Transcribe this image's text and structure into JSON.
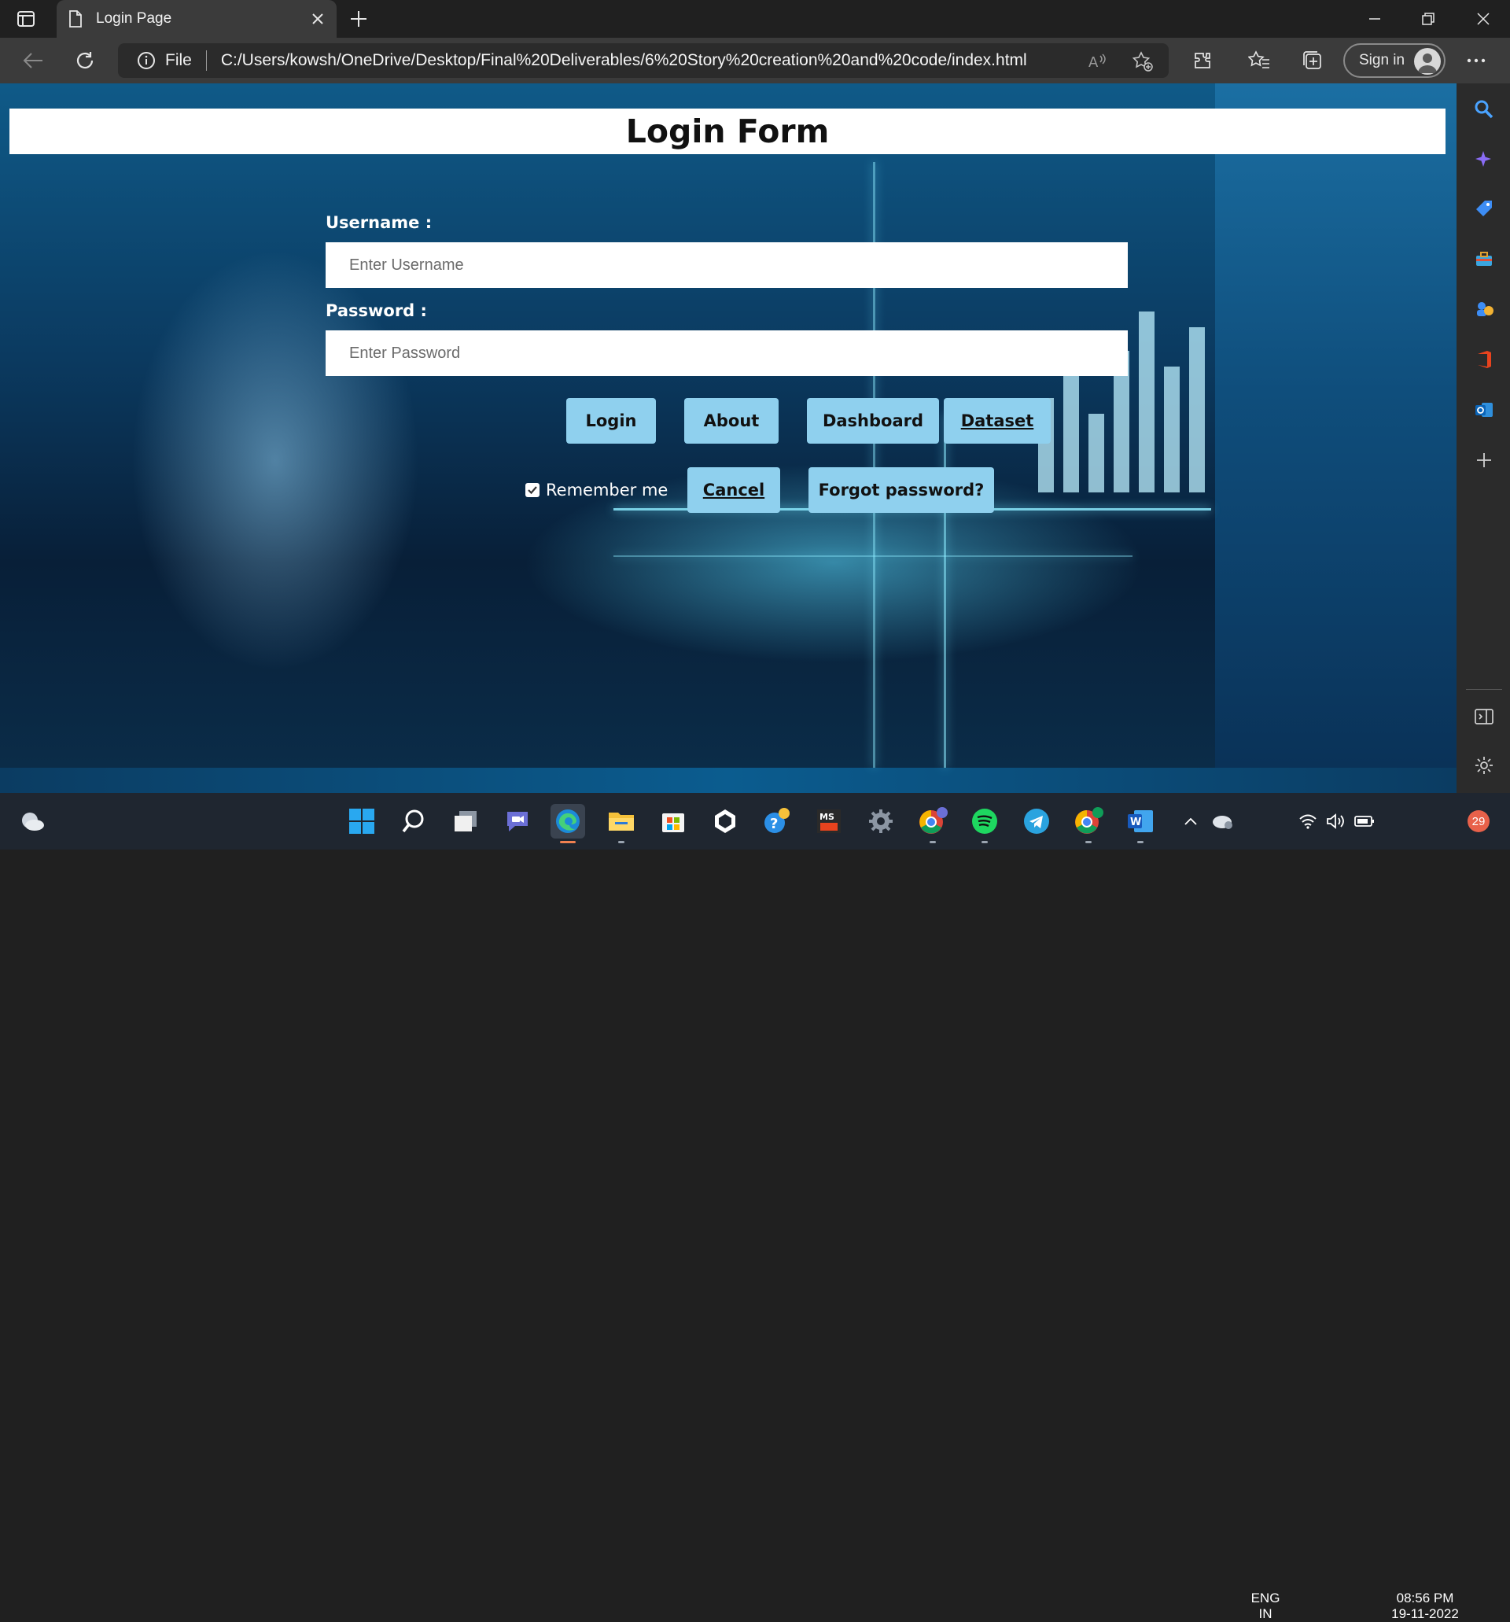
{
  "browser": {
    "tab_title": "Login Page",
    "address_scheme": "File",
    "address_url": "C:/Users/kowsh/OneDrive/Desktop/Final%20Deliverables/6%20Story%20creation%20and%20code/index.html",
    "signin_label": "Sign in"
  },
  "page": {
    "title": "Login Form",
    "username_label": "Username :",
    "username_placeholder": "Enter Username",
    "password_label": "Password :",
    "password_placeholder": "Enter Password",
    "buttons": {
      "login": "Login",
      "about": "About",
      "dashboard": "Dashboard",
      "dataset": "Dataset",
      "cancel": "Cancel",
      "forgot": "Forgot password?"
    },
    "remember_label": "Remember me",
    "remember_checked": true
  },
  "taskbar": {
    "lang_top": "ENG",
    "lang_bottom": "IN",
    "time": "08:56 PM",
    "date": "19-11-2022",
    "notification_count": "29"
  },
  "colors": {
    "button_bg": "#8fd0ee",
    "accent_underline": "#f08050"
  }
}
